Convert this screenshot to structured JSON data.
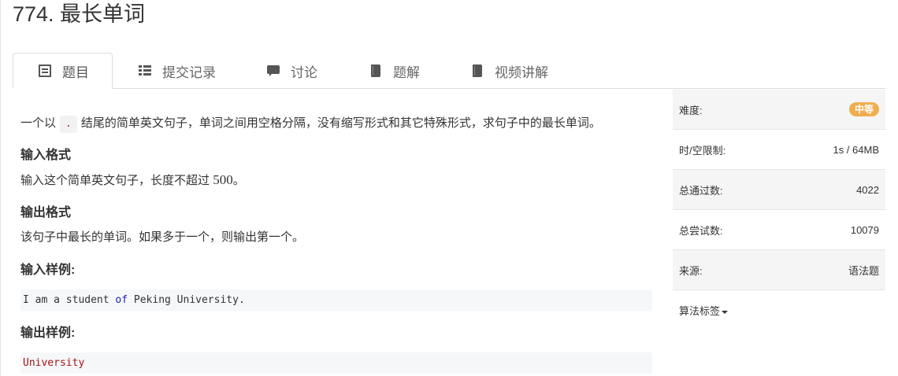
{
  "problem": {
    "title": "774. 最长单词"
  },
  "tabs": [
    {
      "label": "题目",
      "icon": "document-icon",
      "active": true
    },
    {
      "label": "提交记录",
      "icon": "list-icon"
    },
    {
      "label": "讨论",
      "icon": "comment-icon"
    },
    {
      "label": "题解",
      "icon": "book-icon"
    },
    {
      "label": "视频讲解",
      "icon": "book-icon"
    }
  ],
  "content": {
    "desc_before": "一个以",
    "desc_code": ".",
    "desc_after": "结尾的简单英文句子，单词之间用空格分隔，没有缩写形式和其它特殊形式，求句子中的最长单词。",
    "input_format_heading": "输入格式",
    "input_format_before": "输入这个简单英文句子，长度不超过",
    "input_format_num": "500",
    "input_format_after": "。",
    "output_format_heading": "输出格式",
    "output_format_text": "该句子中最长的单词。如果多于一个，则输出第一个。",
    "sample_input_heading": "输入样例:",
    "sample_input_part1": "I am a student ",
    "sample_input_kw": "of",
    "sample_input_part2": " Peking University.",
    "sample_output_heading": "输出样例:",
    "sample_output": "University"
  },
  "sidebar": {
    "difficulty_label": "难度:",
    "difficulty_value": "中等",
    "limit_label": "时/空限制:",
    "limit_value": "1s / 64MB",
    "accepted_label": "总通过数:",
    "accepted_value": "4022",
    "attempts_label": "总尝试数:",
    "attempts_value": "10079",
    "source_label": "来源:",
    "source_value": "语法题",
    "tags_label": "算法标签"
  },
  "colors": {
    "badge": "#f0ad4e",
    "keyword": "#1d22b3",
    "output_text": "#a31515"
  }
}
